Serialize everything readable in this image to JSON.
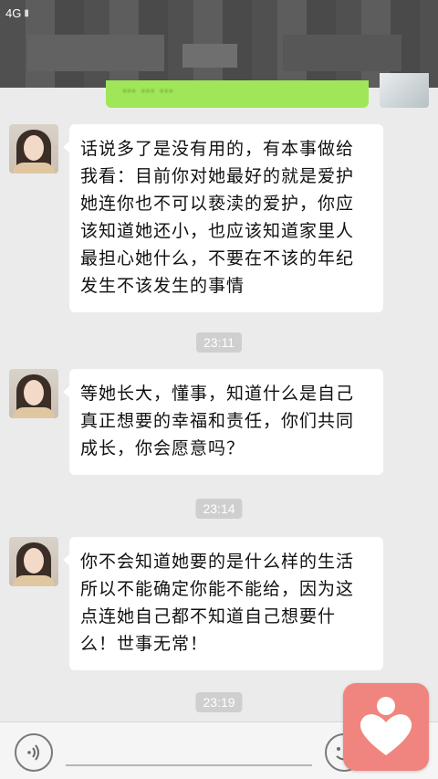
{
  "status_bar": {
    "network": "4G"
  },
  "messages": [
    {
      "text": "话说多了是没有用的，有本事做给我看：目前你对她最好的就是爱护她连你也不可以亵渎的爱护，你应该知道她还小，也应该知道家里人最担心她什么，不要在不该的年纪发生不该发生的事情",
      "lines": [
        "话说多了是没有用的，有本事做给",
        "我看：目前你对她最好的就是爱护",
        "她连你也不可以亵渎的爱护，你应",
        "该知道她还小，也应该知道家里人",
        "最担心她什么，不要在不该的年纪",
        "发生不该发生的事情"
      ]
    },
    {
      "lines": [
        "等她长大，懂事，知道什么是自己",
        "真正想要的幸福和责任，你们共同",
        "成长，你会愿意吗？"
      ]
    },
    {
      "lines": [
        "你不会知道她要的是什么样的生活",
        "所以不能确定你能不能给，因为这",
        "点连她自己都不知道自己想要什",
        "么！世事无常！"
      ]
    }
  ],
  "timestamps": [
    "23:11",
    "23:14",
    "23:19"
  ],
  "colors": {
    "background": "#ebebeb",
    "incoming_bubble": "#ffffff",
    "outgoing_bubble": "#9fe658",
    "timestamp_bg": "#cfcfcf",
    "floating_button": "#f0857f"
  },
  "icons": {
    "voice": "voice-icon",
    "emoji": "emoji-icon",
    "floating": "heart-icon"
  }
}
